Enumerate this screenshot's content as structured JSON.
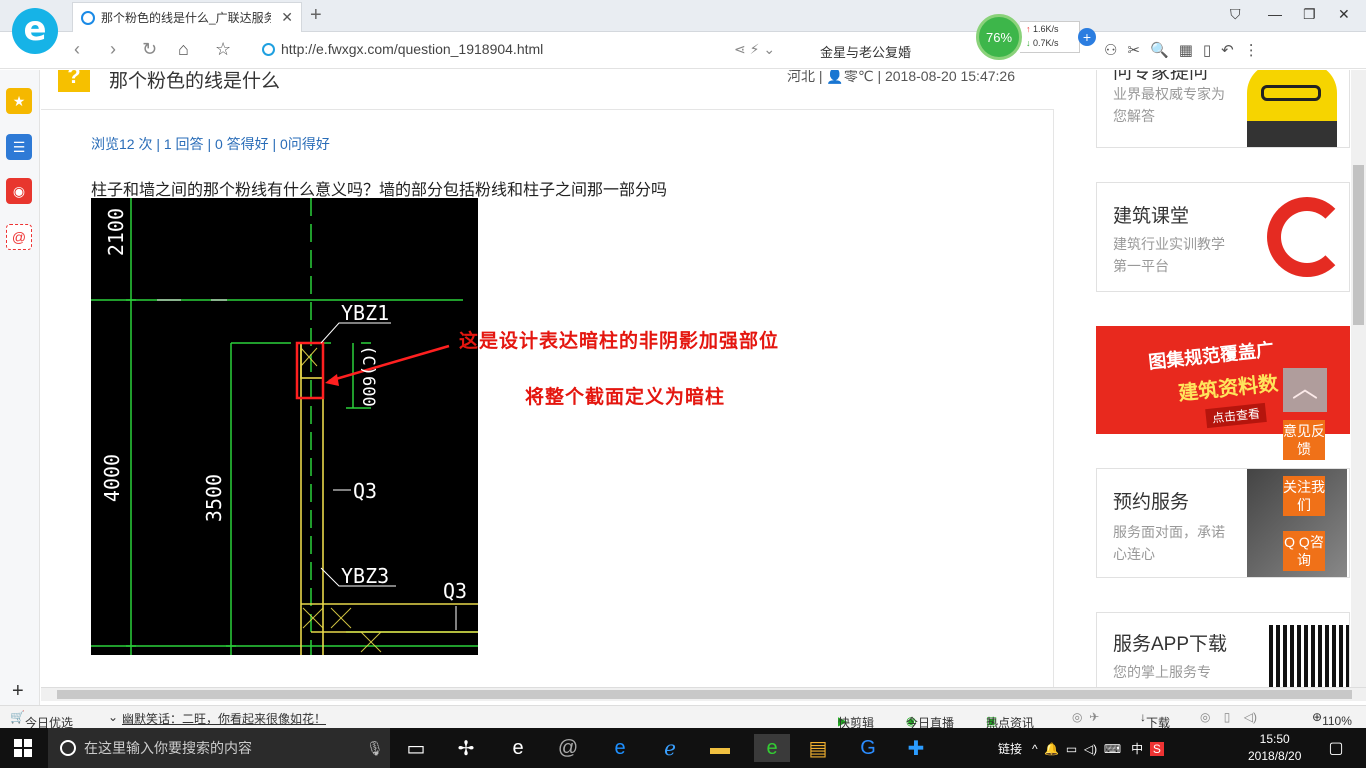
{
  "browser": {
    "tab_title": "那个粉色的线是什么_广联达服务",
    "tab_close": "✕",
    "new_tab": "+",
    "url": "http://e.fwxgx.com/question_1918904.html",
    "search_suggestion": "金星与老公复婚",
    "speed_percent": "76%",
    "upload_rate": "1.6K/s",
    "download_rate": "0.7K/s"
  },
  "question": {
    "title": "那个粉色的线是什么",
    "meta": "河北 | 👤零℃ | 2018-08-20 15:47:26",
    "stats": "浏览12 次 | 1 回答 | 0 答得好 | 0问得好",
    "text": "柱子和墙之间的那个粉线有什么意义吗？墙的部分包括粉线和柱子之间那一部分吗"
  },
  "drawing": {
    "dim_top": "2100",
    "dim_left": "4000",
    "dim_mid": "3500",
    "dim_small": "(C)600",
    "label_ybz1": "YBZ1",
    "label_q3a": "Q3",
    "label_ybz3": "YBZ3",
    "label_q3b": "Q3",
    "annotation1": "这是设计表达暗柱的非阴影加强部位",
    "annotation2": "将整个截面定义为暗柱"
  },
  "sidebar_right": {
    "card1_title": "问专家提问",
    "card1_desc": "业界最权威专家为您解答",
    "card2_title": "建筑课堂",
    "card2_desc": "建筑行业实训教学第一平台",
    "banner_line1": "图集规范覆盖广",
    "banner_line2": "建筑资料数",
    "banner_btn": "点击查看",
    "card4_title": "预约服务",
    "card4_desc": "服务面对面，承诺心连心",
    "card5_title": "服务APP下载",
    "card5_desc": "您的掌上服务专",
    "float1": "意见反馈",
    "float2": "关注我们",
    "float3": "Q Q咨询"
  },
  "statusbar": {
    "today": "今日优选",
    "joke": "幽默笑话：二旺，你看起来很像如花！",
    "kuaijianji": "快剪辑",
    "live": "今日直播",
    "news": "热点资讯",
    "download": "下载",
    "zoom": "110%"
  },
  "taskbar": {
    "search_placeholder": "在这里输入你要搜索的内容",
    "tray_link": "链接",
    "ime": "中",
    "time": "15:50",
    "date": "2018/8/20"
  },
  "colors": {
    "accent_blue": "#2a6db8",
    "annotation_red": "#e4160f",
    "cad_green": "#2bd13a",
    "cad_yellow": "#e8d84a",
    "float_orange": "#f07118"
  }
}
